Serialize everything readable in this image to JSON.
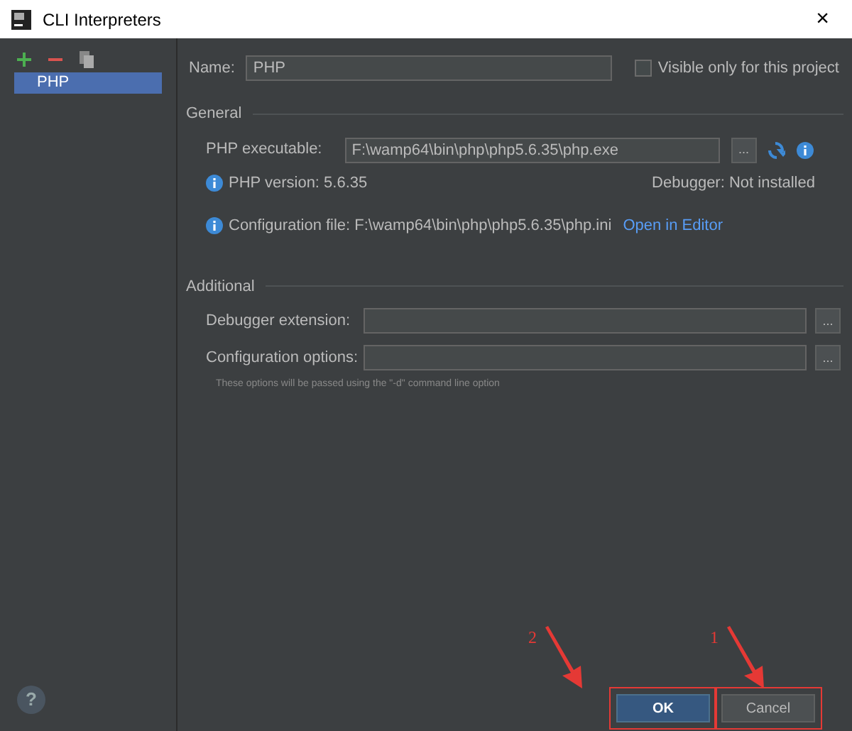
{
  "window": {
    "title": "CLI Interpreters",
    "close": "×"
  },
  "sidebar": {
    "items": [
      {
        "label": "PHP",
        "selected": true
      }
    ]
  },
  "name_field": {
    "label": "Name:",
    "value": "PHP"
  },
  "visible_only": {
    "label": "Visible only for this project",
    "checked": false
  },
  "general": {
    "title": "General",
    "executable_label": "PHP executable:",
    "executable_value": "F:\\wamp64\\bin\\php\\php5.6.35\\php.exe",
    "browse": "...",
    "version": "PHP version: 5.6.35",
    "debugger": "Debugger: Not installed",
    "config_file": "Configuration file: F:\\wamp64\\bin\\php\\php5.6.35\\php.ini",
    "open_editor": "Open in Editor"
  },
  "additional": {
    "title": "Additional",
    "fields": [
      {
        "label": "Debugger extension:",
        "browse": "..."
      },
      {
        "label": "Configuration options:",
        "browse": "..."
      }
    ],
    "hint": "These options will be passed using the \"-d\" command line option"
  },
  "buttons": [
    {
      "label": "OK",
      "primary": true
    },
    {
      "label": "Cancel",
      "primary": false
    }
  ],
  "help": "?",
  "annotations": [
    {
      "number": "2"
    },
    {
      "number": "1"
    }
  ]
}
